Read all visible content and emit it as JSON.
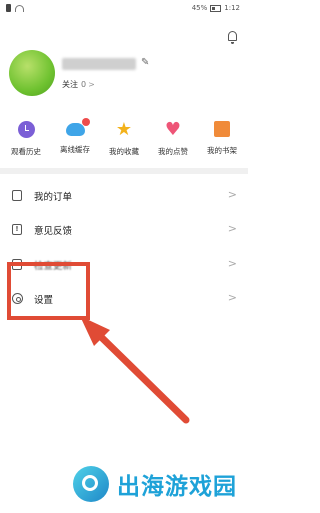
{
  "status_bar": {
    "battery": "45%",
    "time": "1:12"
  },
  "profile": {
    "follow_label": "关注",
    "follow_count": "0",
    "follow_chevron": ">"
  },
  "shortcuts": [
    {
      "label": "观看历史",
      "icon": "history-icon",
      "color": "#7b5fd6"
    },
    {
      "label": "离线缓存",
      "icon": "cloud-download-icon",
      "color": "#3fa5e8"
    },
    {
      "label": "我的收藏",
      "icon": "star-icon",
      "color": "#f3b21b"
    },
    {
      "label": "我的点赞",
      "icon": "heart-icon",
      "color": "#ee5577"
    },
    {
      "label": "我的书架",
      "icon": "bookshelf-icon",
      "color": "#f08b3a"
    }
  ],
  "menu": [
    {
      "label": "我的订单",
      "icon": "order-icon"
    },
    {
      "label": "意见反馈",
      "icon": "feedback-icon",
      "glyph": "!"
    },
    {
      "label": "检查更新",
      "icon": "update-icon"
    },
    {
      "label": "设置",
      "icon": "gear-icon"
    }
  ],
  "chevron": ">",
  "highlight_color": "#e04b35",
  "watermark": {
    "text": "出海游戏园"
  }
}
